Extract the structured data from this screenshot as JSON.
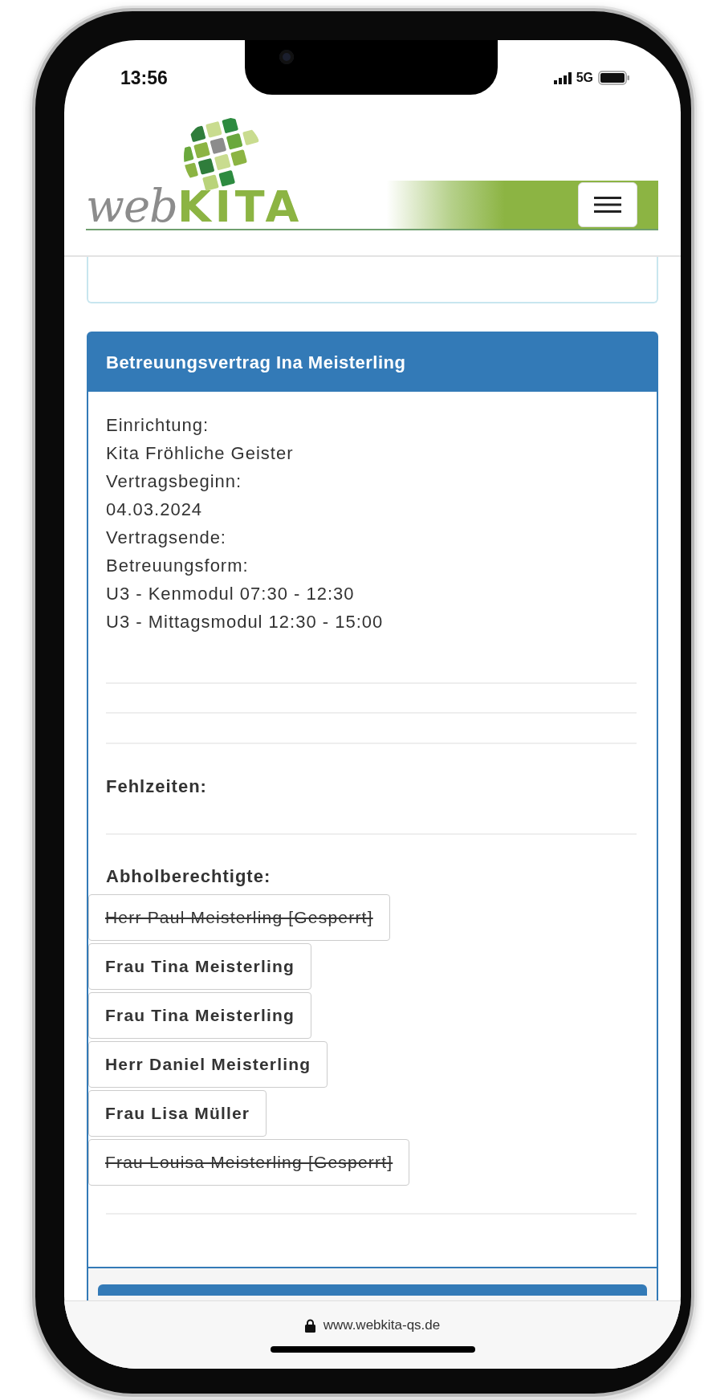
{
  "status_bar": {
    "time": "13:56",
    "network": "5G"
  },
  "header": {
    "logo": {
      "part_1": "web",
      "part_2": "KITA"
    }
  },
  "contract_card": {
    "title": "Betreuungsvertrag Ina Meisterling",
    "details": [
      "Einrichtung:",
      "Kita Fröhliche Geister",
      "Vertragsbeginn:",
      "04.03.2024",
      "Vertragsende:",
      "Betreuungsform:",
      "U3 - Kenmodul 07:30 - 12:30",
      "U3 - Mittagsmodul 12:30 - 15:00"
    ],
    "absences_label": "Fehlzeiten:",
    "pickup_label": "Abholberechtigte:",
    "pickup_persons": [
      {
        "name": "Herr Paul Meisterling [Gesperrt]",
        "blocked": true
      },
      {
        "name": "Frau Tina Meisterling",
        "blocked": false
      },
      {
        "name": "Frau Tina Meisterling",
        "blocked": false
      },
      {
        "name": "Herr Daniel Meisterling",
        "blocked": false
      },
      {
        "name": "Frau Lisa Müller",
        "blocked": false
      },
      {
        "name": "Frau Louisa Meisterling [Gesperrt]",
        "blocked": true
      }
    ]
  },
  "browser_bar": {
    "url": "www.webkita-qs.de"
  }
}
